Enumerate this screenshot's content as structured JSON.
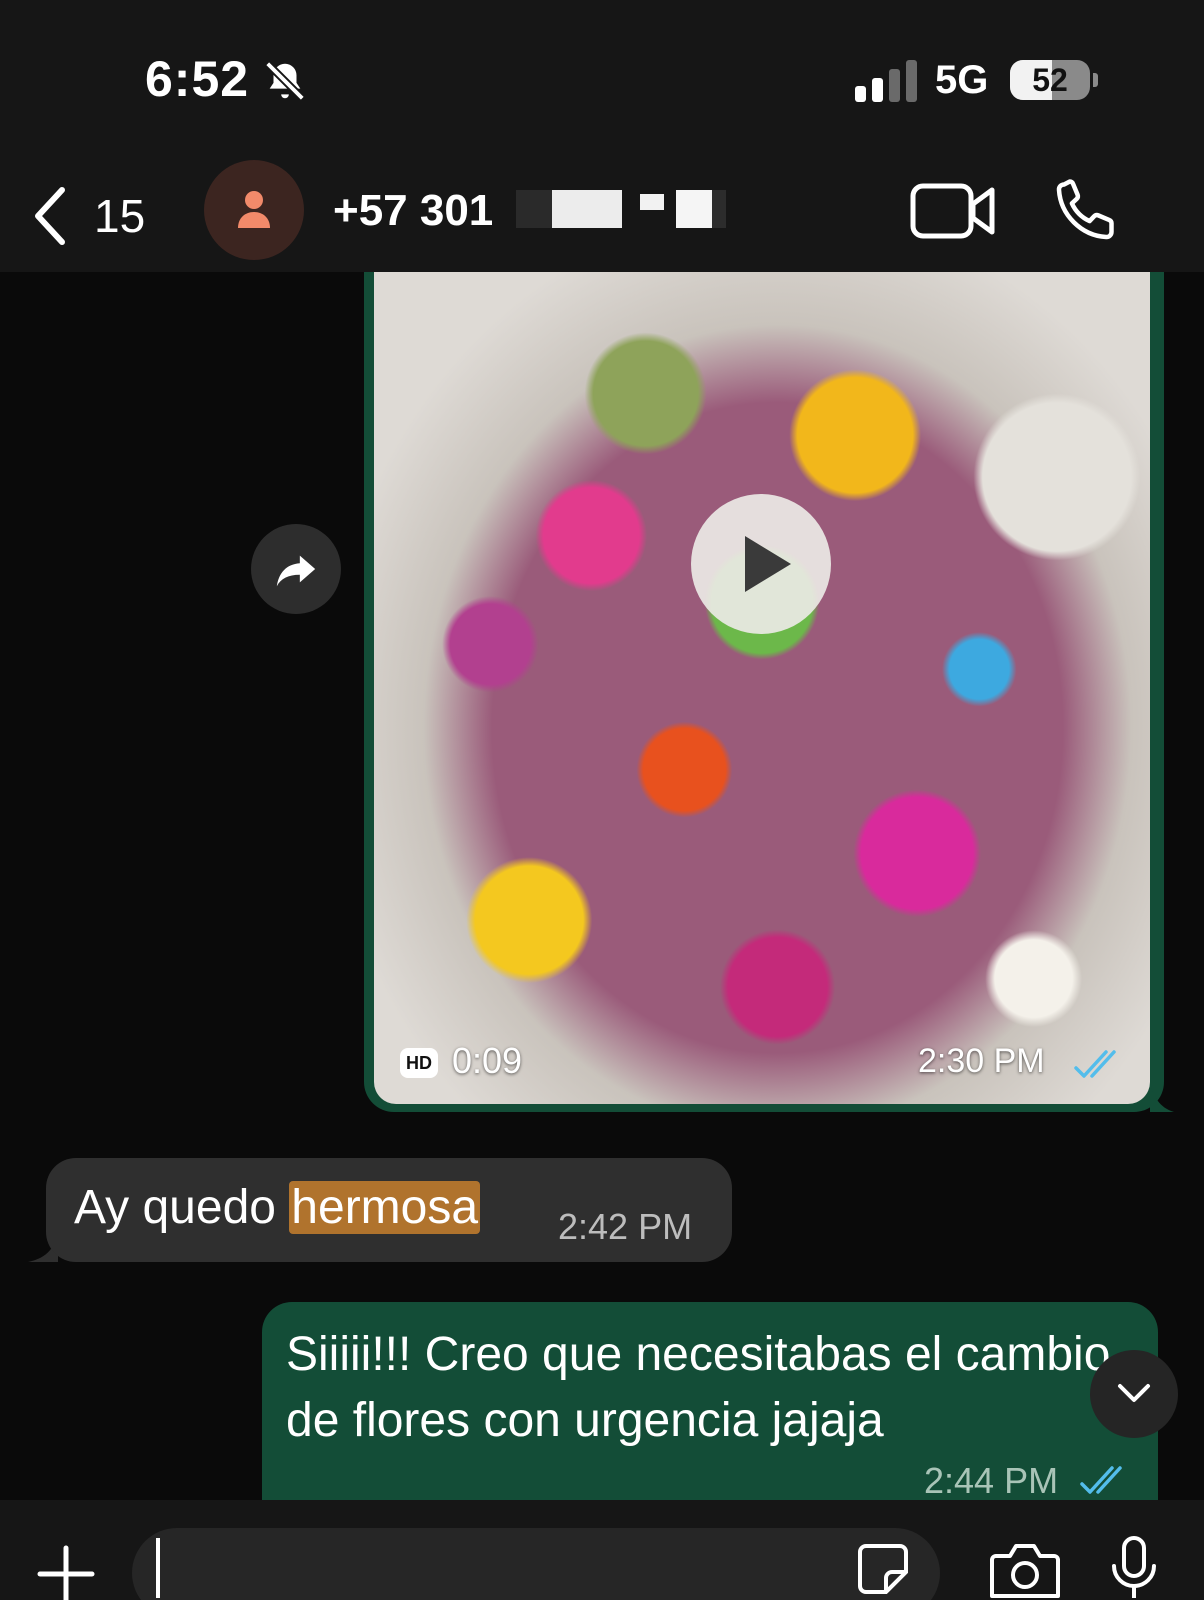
{
  "status_bar": {
    "time": "6:52",
    "network": "5G",
    "battery": "52",
    "battery_level": 0.52
  },
  "header": {
    "unread_count": "15",
    "contact_name": "+57 301"
  },
  "messages": [
    {
      "type": "video",
      "direction": "outgoing",
      "badge": "HD",
      "duration": "0:09",
      "time": "2:30 PM"
    },
    {
      "type": "text",
      "direction": "incoming",
      "text_before": "Ay quedo ",
      "text_highlight": "hermosa",
      "time": "2:42 PM"
    },
    {
      "type": "text",
      "direction": "outgoing",
      "text": "Siiiii!!! Creo que necesitabas el cambio de flores con urgencia jajaja",
      "time": "2:44 PM"
    }
  ],
  "colors": {
    "outgoing_bubble": "#134d37",
    "incoming_bubble": "#2f2f2f",
    "highlight": "#b0732d",
    "read_tick": "#53bdeb"
  }
}
